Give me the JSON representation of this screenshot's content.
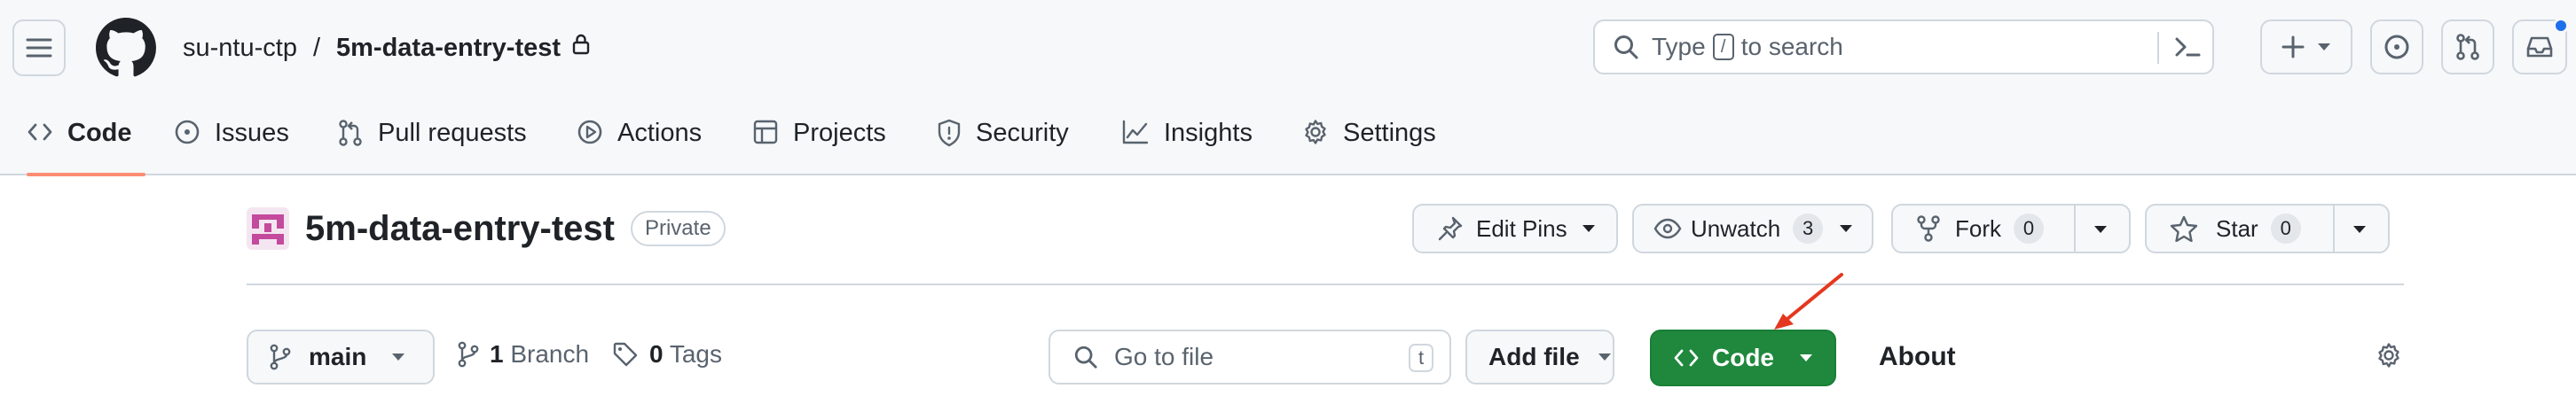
{
  "breadcrumb": {
    "owner": "su-ntu-ctp",
    "separator": "/",
    "repo": "5m-data-entry-test"
  },
  "search": {
    "prefix": "Type",
    "key": "/",
    "suffix": "to search"
  },
  "tabs": [
    {
      "label": "Code",
      "icon": "code-icon",
      "active": true
    },
    {
      "label": "Issues",
      "icon": "issue-opened-icon"
    },
    {
      "label": "Pull requests",
      "icon": "git-pull-request-icon"
    },
    {
      "label": "Actions",
      "icon": "play-icon"
    },
    {
      "label": "Projects",
      "icon": "table-icon"
    },
    {
      "label": "Security",
      "icon": "shield-icon"
    },
    {
      "label": "Insights",
      "icon": "graph-icon"
    },
    {
      "label": "Settings",
      "icon": "gear-icon"
    }
  ],
  "repo": {
    "name": "5m-data-entry-test",
    "visibility": "Private"
  },
  "actions": {
    "edit_pins": "Edit Pins",
    "unwatch": "Unwatch",
    "watch_count": "3",
    "fork": "Fork",
    "fork_count": "0",
    "star": "Star",
    "star_count": "0"
  },
  "toolbar": {
    "branch": "main",
    "branch_count": "1",
    "branch_label": "Branch",
    "tag_count": "0",
    "tag_label": "Tags",
    "go_to_file": "Go to file",
    "go_to_file_key": "t",
    "add_file": "Add file",
    "code": "Code"
  },
  "sidebar": {
    "about": "About"
  },
  "colors": {
    "accent_green": "#1f883d",
    "tab_underline": "#fd8c73",
    "notification_dot": "#1f6feb",
    "annotation_arrow": "#e5371f"
  }
}
